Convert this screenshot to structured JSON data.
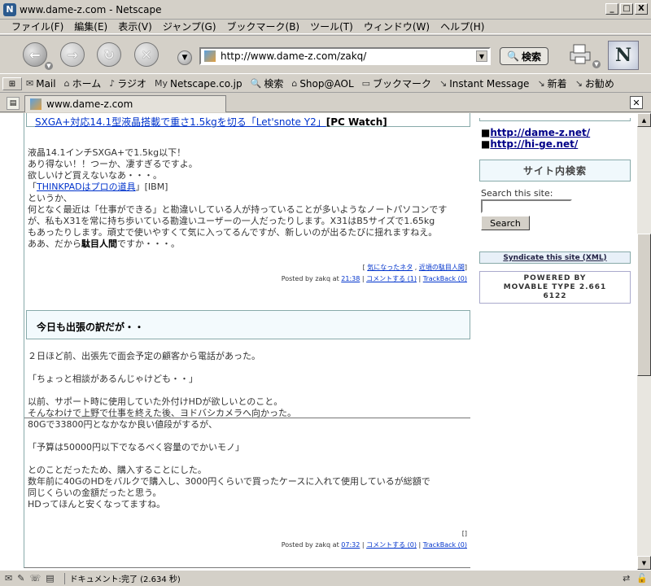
{
  "window": {
    "title": "www.dame-z.com - Netscape",
    "minimize": "_",
    "maximize": "□",
    "close": "X"
  },
  "menu": [
    "ファイル(F)",
    "編集(E)",
    "表示(V)",
    "ジャンプ(G)",
    "ブックマーク(B)",
    "ツール(T)",
    "ウィンドウ(W)",
    "ヘルプ(H)"
  ],
  "nav": {
    "back": "←",
    "forward": "→",
    "reload": "↻",
    "stop": "✕",
    "url": "http://www.dame-z.com/zakq/",
    "search_label": "検索"
  },
  "personal_toolbar": [
    {
      "icon": "✉",
      "label": "Mail"
    },
    {
      "icon": "⌂",
      "label": "ホーム"
    },
    {
      "icon": "♪",
      "label": "ラジオ"
    },
    {
      "icon": "My",
      "label": "Netscape.co.jp"
    },
    {
      "icon": "🔍",
      "label": "検索"
    },
    {
      "icon": "⌂",
      "label": "Shop@AOL"
    },
    {
      "icon": "▭",
      "label": "ブックマーク"
    },
    {
      "icon": "↘",
      "label": "Instant Message"
    },
    {
      "icon": "↘",
      "label": "新着"
    },
    {
      "icon": "↘",
      "label": "お勧め"
    }
  ],
  "tab": {
    "label": "www.dame-z.com"
  },
  "post1": {
    "link_text": "SXGA+対応14.1型液晶搭載で重さ1.5kgを切る「Let'snote Y2」",
    "link_source": "[PC Watch]",
    "lines": [
      "液晶14.1インチSXGA+で1.5kg以下！",
      "あり得ない！！つーか、凄すぎるですよ。",
      "欲しいけど買えないなあ・・・。"
    ],
    "think_pre": "「",
    "think_link": "THINKPADはプロの道具",
    "think_post": "」[IBM]",
    "lines2": [
      "というか、",
      "何となく最近は「仕事ができる」と勘違いしている人が持っていることが多いようなノートパソコンです",
      "が、私もX31を常に持ち歩いている勘違いユーザーの一人だったりします。X31はB5サイズで1.65kg",
      "もあったりします。頑丈で使いやすくて気に入ってるんですが、新しいのが出るたびに揺れますねえ。"
    ],
    "last_pre": "ああ、だから",
    "last_bold": "駄目人間",
    "last_post": "ですか・・・。",
    "categories": [
      "気になったネタ",
      "近頃の駄目人間"
    ],
    "posted_by": "Posted by zakq at",
    "time": "21:38",
    "comment": "コメントする (1)",
    "trackback": "TrackBack (0)"
  },
  "post2": {
    "title": "今日も出張の訳だが・・",
    "paragraphs": [
      [
        "２日ほど前、出張先で面会予定の顧客から電話があった。"
      ],
      [
        "「ちょっと相談があるんじゃけども・・」"
      ],
      [
        "以前、サポート時に使用していた外付けHDが欲しいとのこと。",
        "そんなわけで上野で仕事を終えた後、ヨドバシカメラへ向かった。",
        "80Gで33800円となかなか良い値段がするが、"
      ],
      [
        "「予算は50000円以下でなるべく容量のでかいモノ」"
      ],
      [
        "とのことだったため、購入することにした。",
        "数年前に40GのHDをバルクで購入し、3000円くらいで買ったケースに入れて使用しているが総額で",
        "同じくらいの金額だったと思う。",
        "HDってほんと安くなってますね。"
      ]
    ],
    "category_brackets": "[]",
    "posted_by": "Posted by zakq at",
    "time": "07:32",
    "comment": "コメントする (0)",
    "trackback": "TrackBack (0)"
  },
  "sidebar": {
    "links": [
      "http://dame-z.net/",
      "http://hi-ge.net/"
    ],
    "bullet": "■",
    "search_heading": "サイト内検索",
    "search_label": "Search this site:",
    "search_value": "",
    "search_button": "Search",
    "syndicate": "Syndicate this site (XML)",
    "powered_lines": [
      "POWERED BY",
      "MOVABLE TYPE 2.661",
      "6122"
    ]
  },
  "status": {
    "text": "ドキュメント:完了 (2.634 秒)"
  },
  "colors": {
    "link": "#0033cc",
    "chrome": "#d4d0c8",
    "title_box": "#f3fafd",
    "border": "#88aaaa"
  }
}
